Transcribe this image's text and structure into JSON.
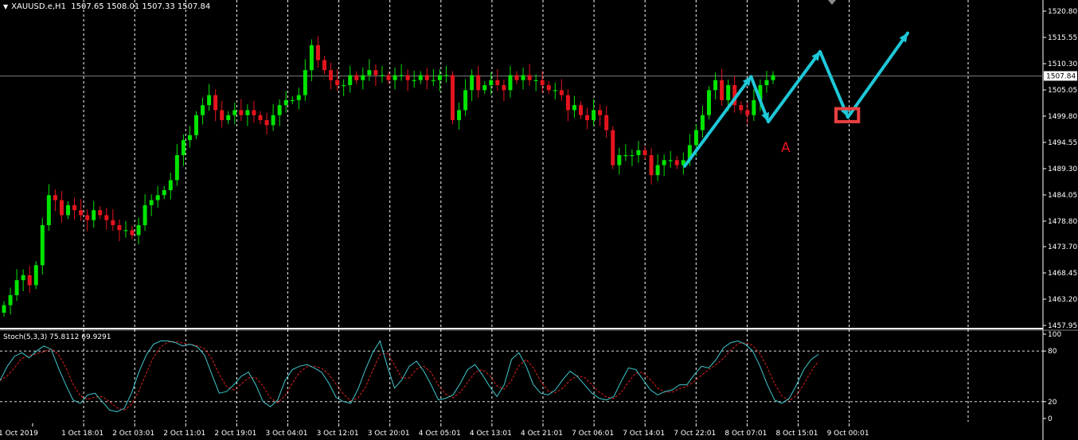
{
  "header": {
    "symbol": "XAUUSD.e,H1",
    "ohlc": "1507.65 1508.01 1507.33 1507.84",
    "collapse_icon": "triangle-down-icon"
  },
  "indicator": {
    "label": "Stoch(5,3,3) 75.8112 69.9291"
  },
  "annotation": {
    "wave_label": "A"
  },
  "colors": {
    "bull": "#00e400",
    "bear": "#e4141e",
    "grid": "#ffffff",
    "arrow": "#1ec8d8",
    "box": "#e84040",
    "stoch_main": "#40c8d0",
    "stoch_signal": "#e02020"
  },
  "chart_data": [
    {
      "type": "candlestick",
      "symbol": "XAUUSD.e",
      "timeframe": "H1",
      "current_price": "1507.84",
      "y_ticks": [
        "1520.80",
        "1515.55",
        "1510.30",
        "1505.05",
        "1499.80",
        "1494.55",
        "1489.30",
        "1484.05",
        "1478.80",
        "1473.70",
        "1468.45",
        "1463.20",
        "1457.95"
      ],
      "x_ticks": [
        "1 Oct 2019",
        "1 Oct 18:01",
        "2 Oct 03:01",
        "2 Oct 11:01",
        "2 Oct 19:01",
        "3 Oct 04:01",
        "3 Oct 12:01",
        "3 Oct 20:01",
        "4 Oct 05:01",
        "4 Oct 13:01",
        "4 Oct 21:01",
        "7 Oct 06:01",
        "7 Oct 14:01",
        "7 Oct 22:01",
        "8 Oct 07:01",
        "8 Oct 15:01",
        "9 Oct 00:01"
      ],
      "ylim": [
        1457.95,
        1520.8
      ],
      "closes": [
        1462,
        1464,
        1467,
        1468,
        1466,
        1470,
        1478,
        1484,
        1483,
        1480,
        1482,
        1481,
        1480,
        1479,
        1481,
        1480,
        1479,
        1478,
        1477,
        1477,
        1476,
        1478,
        1482,
        1483,
        1484,
        1485,
        1487,
        1492,
        1495,
        1496,
        1500,
        1502,
        1504,
        1501,
        1499,
        1500,
        1501,
        1500,
        1501,
        1500,
        1499,
        1498,
        1500,
        1502,
        1503,
        1503,
        1504,
        1509,
        1514,
        1511,
        1509,
        1507,
        1506,
        1506,
        1508,
        1507,
        1508,
        1509,
        1508,
        1508,
        1507,
        1508,
        1508,
        1507,
        1507,
        1508,
        1507,
        1507,
        1508,
        1508,
        1499,
        1501,
        1505,
        1508,
        1505,
        1506,
        1507,
        1506,
        1505,
        1508,
        1507,
        1508,
        1507,
        1507,
        1506,
        1505,
        1505,
        1504,
        1501,
        1502,
        1500,
        1499,
        1501,
        1500,
        1497,
        1490,
        1492,
        1492,
        1492,
        1493,
        1492,
        1488,
        1490,
        1491,
        1491,
        1490,
        1491,
        1494,
        1497,
        1500,
        1505,
        1507,
        1503,
        1506,
        1502,
        1501,
        1500,
        1503,
        1506,
        1507,
        1508
      ],
      "annotation_arrows": [
        {
          "from": 52,
          "to": 57,
          "from_price": 1489.8,
          "to_price": 1507.7
        },
        {
          "from": 57,
          "to": 58.3,
          "from_price": 1507.7,
          "to_price": 1498.7
        },
        {
          "from": 58.3,
          "to": 62.2,
          "from_price": 1498.7,
          "to_price": 1512.7
        },
        {
          "from": 62.2,
          "to": 64.3,
          "from_price": 1512.7,
          "to_price": 1499.6
        },
        {
          "from": 64.3,
          "to": 68.8,
          "from_price": 1499.6,
          "to_price": 1516.4
        }
      ],
      "highlight_box": {
        "from": 63.4,
        "to": 65.1,
        "price_high": 1501.3,
        "price_low": 1498.7
      }
    },
    {
      "type": "line",
      "title": "Stoch(5,3,3)",
      "main_value": "75.8112",
      "signal_value": "69.9291",
      "y_ticks": [
        "100",
        "80",
        "20",
        "0"
      ],
      "ylim": [
        0,
        100
      ],
      "levels": [
        80,
        20
      ],
      "main": [
        45,
        62,
        74,
        78,
        72,
        80,
        86,
        82,
        60,
        40,
        22,
        18,
        28,
        30,
        20,
        10,
        8,
        12,
        30,
        55,
        75,
        88,
        92,
        92,
        90,
        86,
        88,
        85,
        75,
        52,
        30,
        32,
        40,
        50,
        55,
        40,
        20,
        14,
        22,
        45,
        58,
        62,
        64,
        60,
        55,
        42,
        25,
        20,
        18,
        35,
        58,
        78,
        92,
        62,
        36,
        46,
        62,
        68,
        56,
        40,
        22,
        24,
        28,
        42,
        58,
        64,
        52,
        38,
        26,
        40,
        70,
        78,
        62,
        40,
        30,
        28,
        34,
        46,
        56,
        50,
        40,
        30,
        24,
        22,
        26,
        44,
        60,
        58,
        46,
        34,
        28,
        32,
        34,
        40,
        40,
        52,
        62,
        60,
        70,
        84,
        90,
        92,
        88,
        80,
        62,
        40,
        22,
        18,
        24,
        40,
        58,
        70,
        76
      ]
    }
  ]
}
